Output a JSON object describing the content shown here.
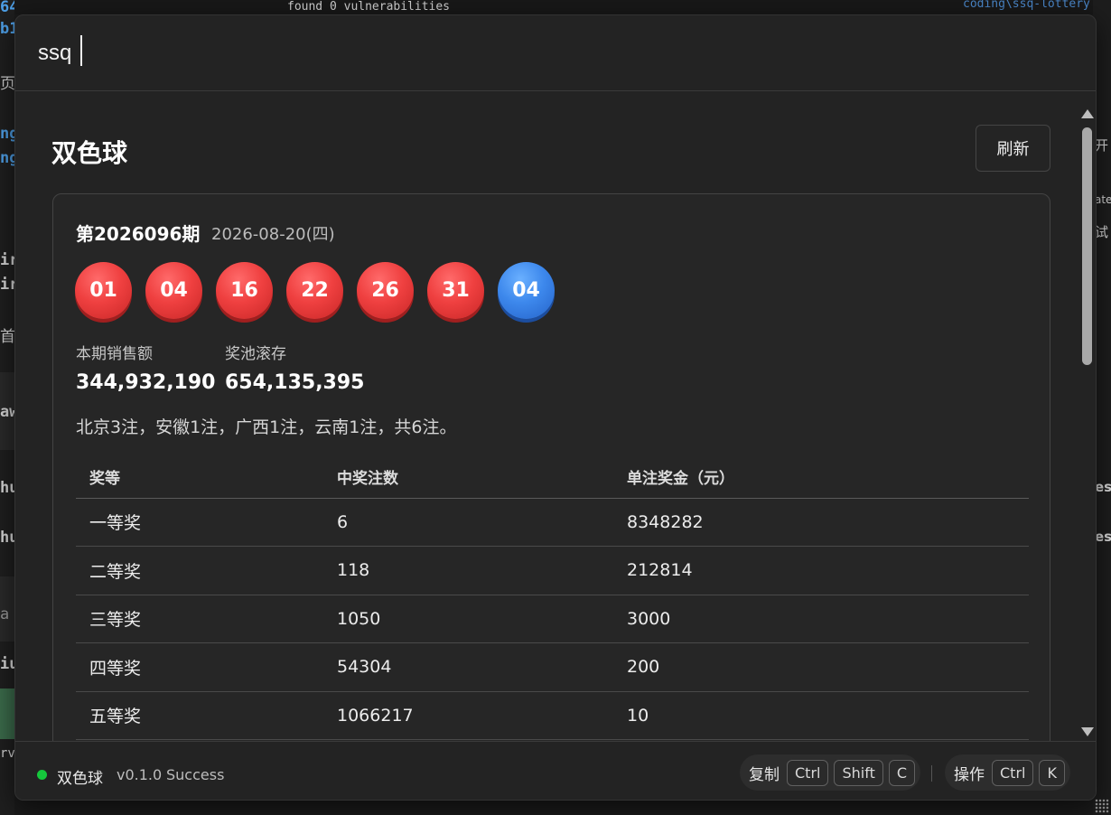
{
  "background": {
    "terminal_line": "found 0 vulnerabilities",
    "path_fragment": "coding\\ssq-lottery",
    "left_fragments": [
      "64",
      "b1",
      "页目",
      "ng",
      "ng",
      "ir",
      "ir",
      "首",
      "aw",
      "hu",
      "hu",
      "a",
      "iu",
      "rv"
    ],
    "right_fragments": [
      "开",
      "ate",
      "试",
      "es",
      "es"
    ]
  },
  "search": {
    "value": "ssq",
    "placeholder": ""
  },
  "header": {
    "title": "双色球",
    "refresh_label": "刷新"
  },
  "draw": {
    "issue": "第2026096期",
    "date": "2026-08-20(四)",
    "red_balls": [
      "01",
      "04",
      "16",
      "22",
      "26",
      "31"
    ],
    "blue_ball": "04",
    "sales_label": "本期销售额",
    "sales_value": "344,932,190",
    "pool_label": "奖池滚存",
    "pool_value": "654,135,395",
    "summary": "北京3注，安徽1注，广西1注，云南1注，共6注。"
  },
  "table": {
    "headers": [
      "奖等",
      "中奖注数",
      "单注奖金（元）"
    ],
    "rows": [
      [
        "一等奖",
        "6",
        "8348282"
      ],
      [
        "二等奖",
        "118",
        "212814"
      ],
      [
        "三等奖",
        "1050",
        "3000"
      ],
      [
        "四等奖",
        "54304",
        "200"
      ],
      [
        "五等奖",
        "1066217",
        "10"
      ]
    ]
  },
  "footer": {
    "status_color": "#15c83c",
    "name": "双色球",
    "version": "v0.1.0",
    "status": "Success",
    "copy_label": "复制",
    "copy_keys": [
      "Ctrl",
      "Shift",
      "C"
    ],
    "action_label": "操作",
    "action_keys": [
      "Ctrl",
      "K"
    ]
  },
  "colors": {
    "red_ball": "#ef4040",
    "blue_ball": "#3d88ec",
    "background": "#232323"
  }
}
